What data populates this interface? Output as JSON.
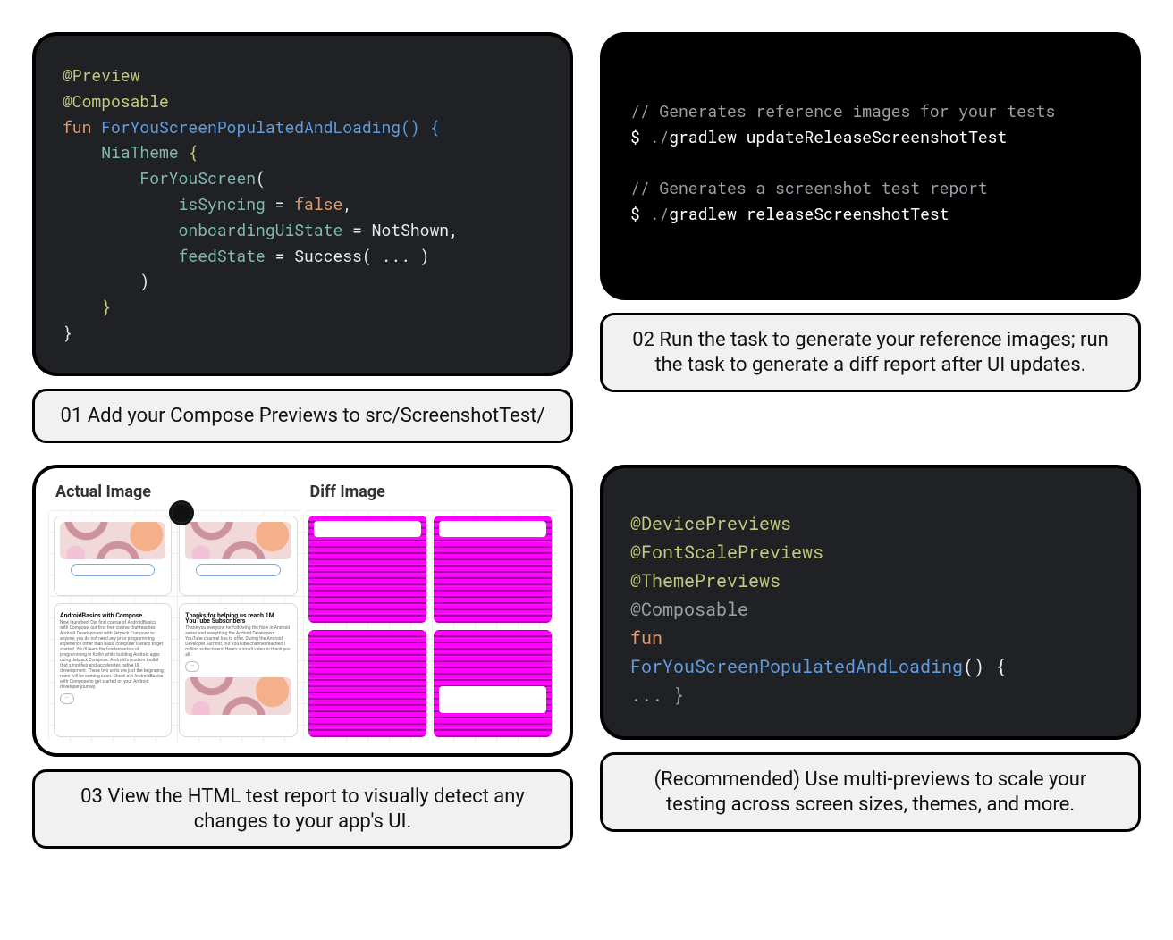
{
  "steps": [
    {
      "caption": "01 Add your Compose Previews to src/ScreenshotTest/",
      "code": {
        "lines": [
          {
            "segments": [
              {
                "t": "@Preview",
                "c": "tok-anno"
              }
            ]
          },
          {
            "segments": [
              {
                "t": "@Composable",
                "c": "tok-anno"
              }
            ]
          },
          {
            "segments": [
              {
                "t": "fun ",
                "c": "tok-keyword"
              },
              {
                "t": "ForYouScreenPopulatedAndLoading",
                "c": "tok-type"
              },
              {
                "t": "() {",
                "c": "tok-paren"
              }
            ]
          },
          {
            "segments": [
              {
                "t": "    ",
                "c": ""
              },
              {
                "t": "NiaTheme ",
                "c": "tok-member"
              },
              {
                "t": "{",
                "c": "tok-braces"
              }
            ]
          },
          {
            "segments": [
              {
                "t": "        ",
                "c": ""
              },
              {
                "t": "ForYouScreen",
                "c": "tok-member"
              },
              {
                "t": "(",
                "c": "tok-punct"
              }
            ]
          },
          {
            "segments": [
              {
                "t": "            ",
                "c": ""
              },
              {
                "t": "isSyncing",
                "c": "tok-param"
              },
              {
                "t": " = ",
                "c": "tok-punct"
              },
              {
                "t": "false",
                "c": "tok-false"
              },
              {
                "t": ",",
                "c": "tok-punct"
              }
            ]
          },
          {
            "segments": [
              {
                "t": "            ",
                "c": ""
              },
              {
                "t": "onboardingUiState",
                "c": "tok-param"
              },
              {
                "t": " = NotShown,",
                "c": "tok-value"
              }
            ]
          },
          {
            "segments": [
              {
                "t": "            ",
                "c": ""
              },
              {
                "t": "feedState",
                "c": "tok-param"
              },
              {
                "t": " = Success( ... )",
                "c": "tok-value"
              }
            ]
          },
          {
            "segments": [
              {
                "t": "        )",
                "c": "tok-punct"
              }
            ]
          },
          {
            "segments": [
              {
                "t": "    ",
                "c": ""
              },
              {
                "t": "}",
                "c": "tok-braces"
              }
            ]
          },
          {
            "segments": [
              {
                "t": "}",
                "c": "tok-punct"
              }
            ]
          }
        ]
      }
    },
    {
      "caption": "02 Run the task to generate your reference images; run the task to generate a diff report after UI updates.",
      "code": {
        "lines": [
          {
            "segments": [
              {
                "t": "// Generates reference images for your tests",
                "c": "tok-comment"
              }
            ]
          },
          {
            "segments": [
              {
                "t": "$ ",
                "c": "tok-prompt"
              },
              {
                "t": "./",
                "c": "tok-dim"
              },
              {
                "t": "gradlew updateReleaseScreenshotTest",
                "c": "tok-cmd"
              }
            ]
          },
          {
            "segments": [
              {
                "t": " ",
                "c": ""
              }
            ]
          },
          {
            "segments": [
              {
                "t": "// Generates a screenshot test report",
                "c": "tok-comment"
              }
            ]
          },
          {
            "segments": [
              {
                "t": "$ ",
                "c": "tok-prompt"
              },
              {
                "t": "./",
                "c": "tok-dim"
              },
              {
                "t": "gradlew releaseScreenshotTest",
                "c": "tok-cmd"
              }
            ]
          }
        ]
      }
    },
    {
      "caption": "03 View the HTML test report to visually detect any changes to your app's UI.",
      "report": {
        "headers": [
          "Actual Image",
          "Diff Image"
        ],
        "actualCards": [
          {
            "title": "",
            "text": ""
          },
          {
            "title": "",
            "text": ""
          },
          {
            "title": "AndroidBasics with Compose",
            "text": "Now launched! Our first course of AndroidBasics with Compose, our first free course that teaches Android Development with Jetpack Compose to anyone; you do not need any prior programming experience other than basic computer literacy to get started. You'll learn the fundamentals of programming in Kotlin while building Android apps using Jetpack Compose. Android's modern toolkit that simplifies and accelerates native UI development. These two units are just the beginning; more will be coming soon. Check out AndroidBasics with Compose to get started on your Android developer journey."
          },
          {
            "title": "Thanks for helping us reach 1M YouTube Subscribers",
            "text": "Thank you everyone for following the Now in Android series and everything the Android Developers YouTube channel has to offer. During the Android Developer Summit, our YouTube channel reached 1 million subscribers! Here's a small video to thank you all."
          }
        ]
      }
    },
    {
      "caption": "(Recommended) Use multi-previews to scale your testing across screen sizes, themes, and more.",
      "code": {
        "lines": [
          {
            "segments": [
              {
                "t": "@DevicePreviews",
                "c": "tok-anno"
              }
            ]
          },
          {
            "segments": [
              {
                "t": "@FontScalePreviews",
                "c": "tok-anno"
              }
            ]
          },
          {
            "segments": [
              {
                "t": "@ThemePreviews",
                "c": "tok-anno"
              }
            ]
          },
          {
            "segments": [
              {
                "t": "@Composable",
                "c": "tok-dim"
              }
            ]
          },
          {
            "segments": [
              {
                "t": "fun",
                "c": "tok-keyword"
              }
            ]
          },
          {
            "segments": [
              {
                "t": "ForYouScreenPopulatedAndLoading",
                "c": "tok-type"
              },
              {
                "t": "() {",
                "c": "tok-punct"
              }
            ]
          },
          {
            "segments": [
              {
                "t": "... }",
                "c": "tok-dim"
              }
            ]
          }
        ]
      }
    }
  ]
}
